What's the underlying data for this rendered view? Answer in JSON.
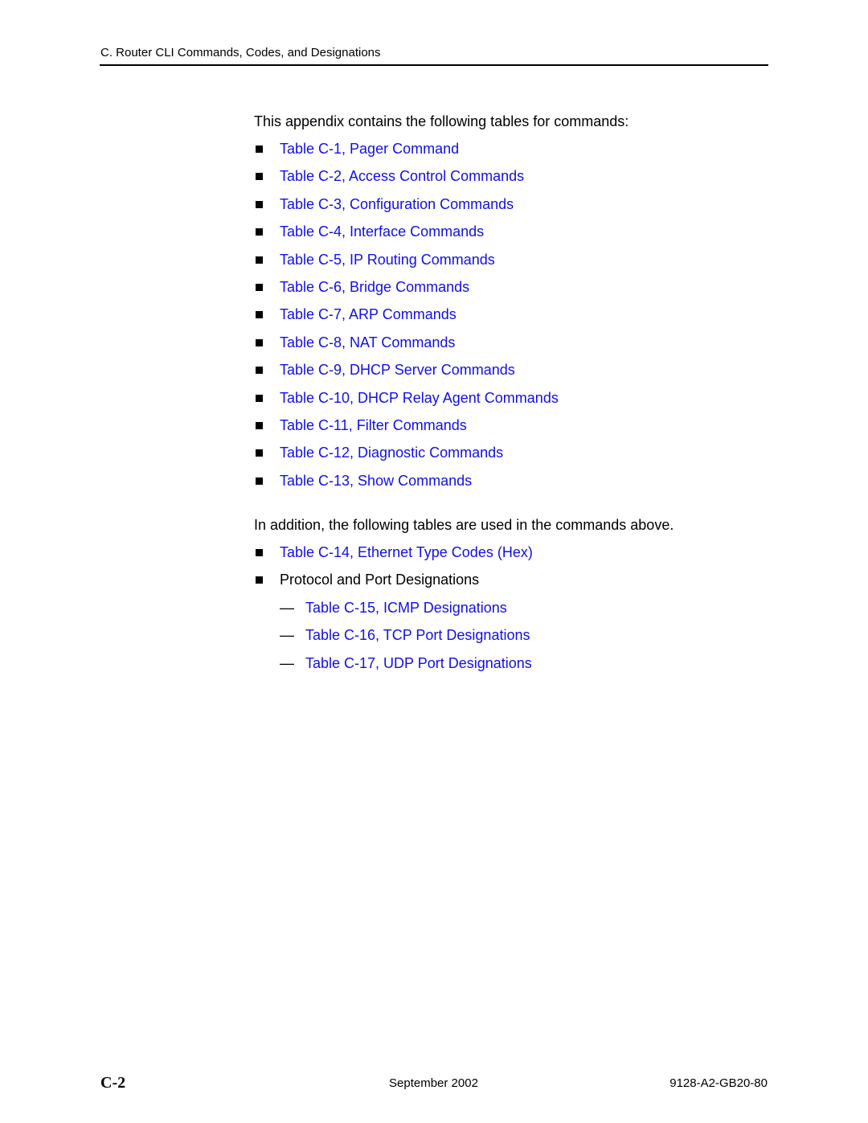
{
  "header": {
    "title": "C. Router CLI Commands, Codes, and Designations"
  },
  "intro": "This appendix contains the following tables for commands:",
  "command_tables": [
    "Table C-1, Pager Command",
    "Table C-2, Access Control Commands",
    "Table C-3, Configuration Commands",
    "Table C-4, Interface Commands",
    "Table C-5, IP Routing Commands",
    "Table C-6, Bridge Commands",
    "Table C-7, ARP Commands",
    "Table C-8, NAT Commands",
    "Table C-9, DHCP Server Commands",
    "Table C-10, DHCP Relay Agent Commands",
    "Table C-11, Filter Commands",
    "Table C-12, Diagnostic Commands",
    "Table C-13, Show Commands"
  ],
  "intro2": "In addition, the following tables are used in the commands above.",
  "additional_tables": {
    "ethernet": "Table C-14, Ethernet Type Codes (Hex)",
    "protocol_heading": "Protocol and Port Designations",
    "protocol_items": [
      "Table C-15, ICMP Designations",
      "Table C-16, TCP Port Designations",
      "Table C-17, UDP Port Designations"
    ],
    "dash": "—"
  },
  "footer": {
    "page": "C-2",
    "date": "September 2002",
    "doc_number": "9128-A2-GB20-80"
  },
  "colors": {
    "link": "#1010e8",
    "text": "#000000"
  }
}
